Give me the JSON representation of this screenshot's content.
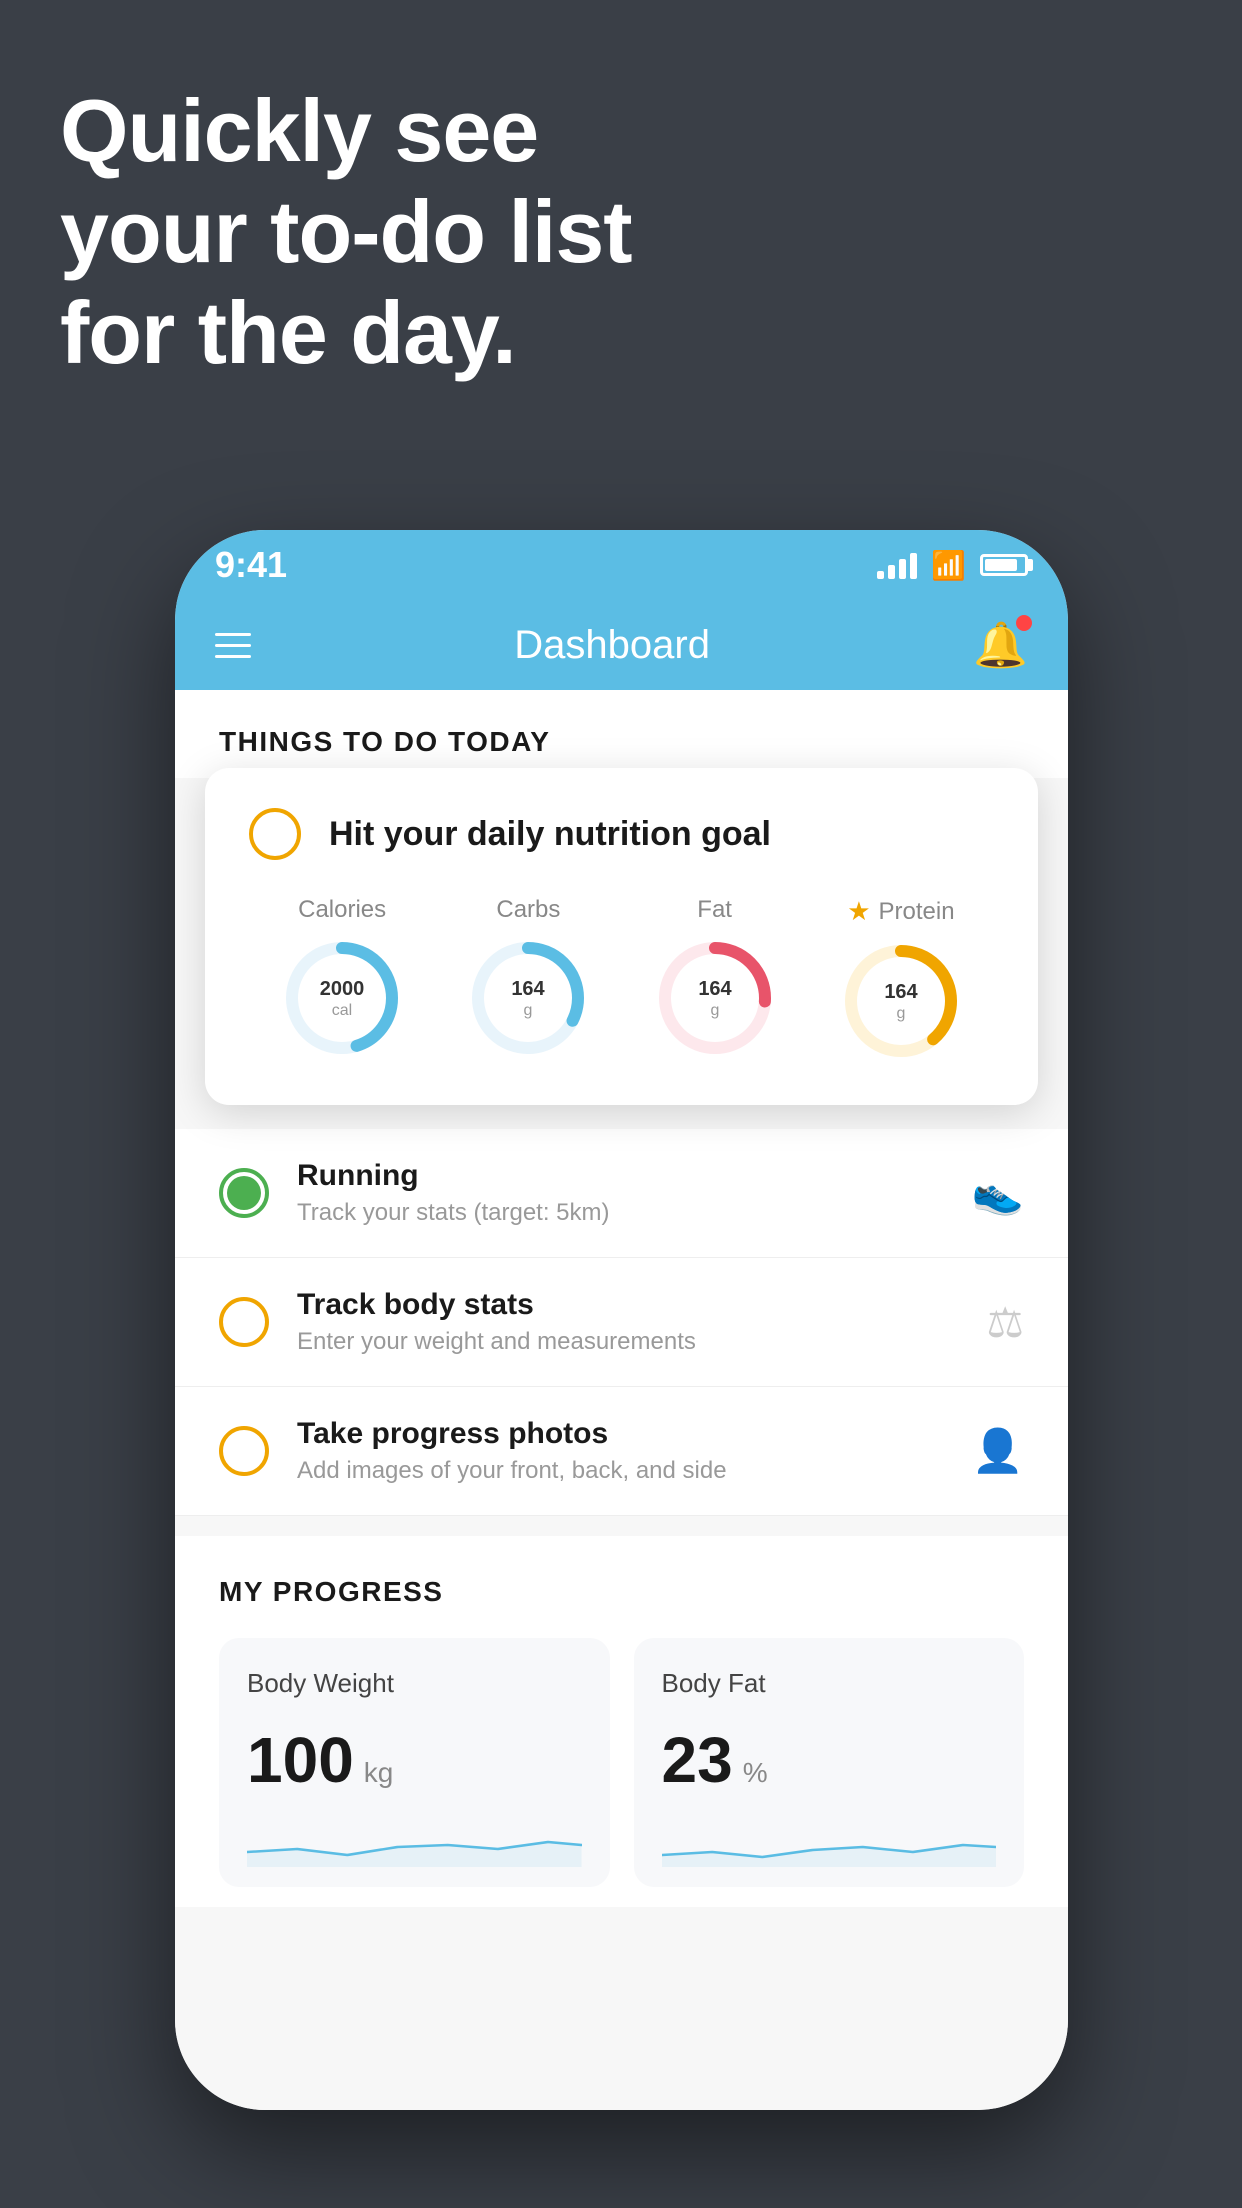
{
  "headline": {
    "line1": "Quickly see",
    "line2": "your to-do list",
    "line3": "for the day."
  },
  "status_bar": {
    "time": "9:41",
    "signal_alt": "signal bars",
    "wifi_alt": "wifi",
    "battery_alt": "battery"
  },
  "app_header": {
    "title": "Dashboard",
    "menu_alt": "menu",
    "bell_alt": "notifications"
  },
  "things_section": {
    "title": "THINGS TO DO TODAY"
  },
  "nutrition_card": {
    "title": "Hit your daily nutrition goal",
    "calories_label": "Calories",
    "calories_value": "2000",
    "calories_unit": "cal",
    "carbs_label": "Carbs",
    "carbs_value": "164",
    "carbs_unit": "g",
    "fat_label": "Fat",
    "fat_value": "164",
    "fat_unit": "g",
    "protein_label": "Protein",
    "protein_value": "164",
    "protein_unit": "g"
  },
  "todo_items": [
    {
      "title": "Running",
      "subtitle": "Track your stats (target: 5km)",
      "status": "complete",
      "icon": "shoe"
    },
    {
      "title": "Track body stats",
      "subtitle": "Enter your weight and measurements",
      "status": "pending",
      "icon": "scale"
    },
    {
      "title": "Take progress photos",
      "subtitle": "Add images of your front, back, and side",
      "status": "pending",
      "icon": "person"
    }
  ],
  "progress_section": {
    "title": "MY PROGRESS",
    "body_weight_label": "Body Weight",
    "body_weight_value": "100",
    "body_weight_unit": "kg",
    "body_fat_label": "Body Fat",
    "body_fat_value": "23",
    "body_fat_unit": "%"
  }
}
